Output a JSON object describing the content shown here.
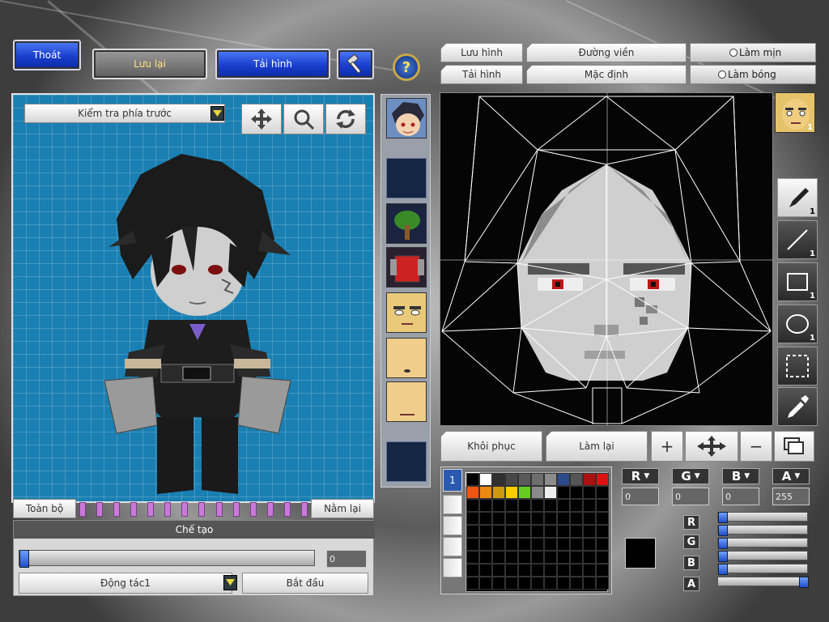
{
  "topbar": {
    "exit_label": "Thoát",
    "save_label": "Lưu lại",
    "reload_label": "Tải hình"
  },
  "left_panel": {
    "view_select": "Kiểm tra phía trước",
    "reset_all_label": "Toàn bộ",
    "lie_down_label": "Nằm lại",
    "create_title": "Chế tạo",
    "progress_value": "0",
    "progress_fraction": 0,
    "action_select": "Động tác1",
    "start_label": "Bắt đầu"
  },
  "editor": {
    "save_tab": "Lưu hình",
    "load_tab": "Tải hình",
    "outline_tab": "Đường viền",
    "default_tab": "Mặc định",
    "smooth_label": "Làm mịn",
    "shadow_label": "Làm bóng",
    "restore_label": "Khôi phục",
    "redo_label": "Làm lại"
  },
  "tools": [
    {
      "name": "pen",
      "count": "1"
    },
    {
      "name": "line",
      "count": "1"
    },
    {
      "name": "rect",
      "count": "1"
    },
    {
      "name": "ellipse",
      "count": "1"
    },
    {
      "name": "select",
      "count": ""
    },
    {
      "name": "dropper",
      "count": ""
    }
  ],
  "face_badge": "1",
  "palette_tab": "1",
  "palette_colors": [
    "#000000",
    "#ffffff",
    "#303030",
    "#484848",
    "#5a5a5a",
    "#6e6e6e",
    "#8c8c8c",
    "#2a4a8a",
    "#555555",
    "#aa1111",
    "#dd1111",
    "#ee5511",
    "#ee8811",
    "#cc9911",
    "#ffcc00",
    "#66cc22",
    "#8a8a8a",
    "#eeeeee"
  ],
  "color_channels": {
    "r": {
      "label": "R",
      "value": "0",
      "fraction": 0
    },
    "g": {
      "label": "G",
      "value": "0",
      "fraction": 0
    },
    "b": {
      "label": "B",
      "value": "0",
      "fraction": 0
    },
    "a": {
      "label": "A",
      "value": "255",
      "fraction": 1
    }
  },
  "current_color": "#000000",
  "accent": "#1a7fb2"
}
